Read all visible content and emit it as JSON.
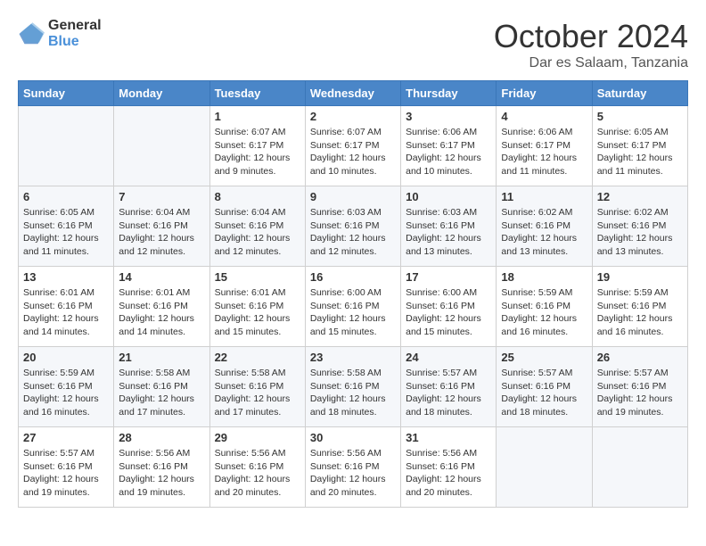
{
  "header": {
    "logo_general": "General",
    "logo_blue": "Blue",
    "month": "October 2024",
    "location": "Dar es Salaam, Tanzania"
  },
  "days_of_week": [
    "Sunday",
    "Monday",
    "Tuesday",
    "Wednesday",
    "Thursday",
    "Friday",
    "Saturday"
  ],
  "weeks": [
    [
      {
        "day": "",
        "empty": true
      },
      {
        "day": "",
        "empty": true
      },
      {
        "day": "1",
        "sunrise": "Sunrise: 6:07 AM",
        "sunset": "Sunset: 6:17 PM",
        "daylight": "Daylight: 12 hours and 9 minutes."
      },
      {
        "day": "2",
        "sunrise": "Sunrise: 6:07 AM",
        "sunset": "Sunset: 6:17 PM",
        "daylight": "Daylight: 12 hours and 10 minutes."
      },
      {
        "day": "3",
        "sunrise": "Sunrise: 6:06 AM",
        "sunset": "Sunset: 6:17 PM",
        "daylight": "Daylight: 12 hours and 10 minutes."
      },
      {
        "day": "4",
        "sunrise": "Sunrise: 6:06 AM",
        "sunset": "Sunset: 6:17 PM",
        "daylight": "Daylight: 12 hours and 11 minutes."
      },
      {
        "day": "5",
        "sunrise": "Sunrise: 6:05 AM",
        "sunset": "Sunset: 6:17 PM",
        "daylight": "Daylight: 12 hours and 11 minutes."
      }
    ],
    [
      {
        "day": "6",
        "sunrise": "Sunrise: 6:05 AM",
        "sunset": "Sunset: 6:16 PM",
        "daylight": "Daylight: 12 hours and 11 minutes."
      },
      {
        "day": "7",
        "sunrise": "Sunrise: 6:04 AM",
        "sunset": "Sunset: 6:16 PM",
        "daylight": "Daylight: 12 hours and 12 minutes."
      },
      {
        "day": "8",
        "sunrise": "Sunrise: 6:04 AM",
        "sunset": "Sunset: 6:16 PM",
        "daylight": "Daylight: 12 hours and 12 minutes."
      },
      {
        "day": "9",
        "sunrise": "Sunrise: 6:03 AM",
        "sunset": "Sunset: 6:16 PM",
        "daylight": "Daylight: 12 hours and 12 minutes."
      },
      {
        "day": "10",
        "sunrise": "Sunrise: 6:03 AM",
        "sunset": "Sunset: 6:16 PM",
        "daylight": "Daylight: 12 hours and 13 minutes."
      },
      {
        "day": "11",
        "sunrise": "Sunrise: 6:02 AM",
        "sunset": "Sunset: 6:16 PM",
        "daylight": "Daylight: 12 hours and 13 minutes."
      },
      {
        "day": "12",
        "sunrise": "Sunrise: 6:02 AM",
        "sunset": "Sunset: 6:16 PM",
        "daylight": "Daylight: 12 hours and 13 minutes."
      }
    ],
    [
      {
        "day": "13",
        "sunrise": "Sunrise: 6:01 AM",
        "sunset": "Sunset: 6:16 PM",
        "daylight": "Daylight: 12 hours and 14 minutes."
      },
      {
        "day": "14",
        "sunrise": "Sunrise: 6:01 AM",
        "sunset": "Sunset: 6:16 PM",
        "daylight": "Daylight: 12 hours and 14 minutes."
      },
      {
        "day": "15",
        "sunrise": "Sunrise: 6:01 AM",
        "sunset": "Sunset: 6:16 PM",
        "daylight": "Daylight: 12 hours and 15 minutes."
      },
      {
        "day": "16",
        "sunrise": "Sunrise: 6:00 AM",
        "sunset": "Sunset: 6:16 PM",
        "daylight": "Daylight: 12 hours and 15 minutes."
      },
      {
        "day": "17",
        "sunrise": "Sunrise: 6:00 AM",
        "sunset": "Sunset: 6:16 PM",
        "daylight": "Daylight: 12 hours and 15 minutes."
      },
      {
        "day": "18",
        "sunrise": "Sunrise: 5:59 AM",
        "sunset": "Sunset: 6:16 PM",
        "daylight": "Daylight: 12 hours and 16 minutes."
      },
      {
        "day": "19",
        "sunrise": "Sunrise: 5:59 AM",
        "sunset": "Sunset: 6:16 PM",
        "daylight": "Daylight: 12 hours and 16 minutes."
      }
    ],
    [
      {
        "day": "20",
        "sunrise": "Sunrise: 5:59 AM",
        "sunset": "Sunset: 6:16 PM",
        "daylight": "Daylight: 12 hours and 16 minutes."
      },
      {
        "day": "21",
        "sunrise": "Sunrise: 5:58 AM",
        "sunset": "Sunset: 6:16 PM",
        "daylight": "Daylight: 12 hours and 17 minutes."
      },
      {
        "day": "22",
        "sunrise": "Sunrise: 5:58 AM",
        "sunset": "Sunset: 6:16 PM",
        "daylight": "Daylight: 12 hours and 17 minutes."
      },
      {
        "day": "23",
        "sunrise": "Sunrise: 5:58 AM",
        "sunset": "Sunset: 6:16 PM",
        "daylight": "Daylight: 12 hours and 18 minutes."
      },
      {
        "day": "24",
        "sunrise": "Sunrise: 5:57 AM",
        "sunset": "Sunset: 6:16 PM",
        "daylight": "Daylight: 12 hours and 18 minutes."
      },
      {
        "day": "25",
        "sunrise": "Sunrise: 5:57 AM",
        "sunset": "Sunset: 6:16 PM",
        "daylight": "Daylight: 12 hours and 18 minutes."
      },
      {
        "day": "26",
        "sunrise": "Sunrise: 5:57 AM",
        "sunset": "Sunset: 6:16 PM",
        "daylight": "Daylight: 12 hours and 19 minutes."
      }
    ],
    [
      {
        "day": "27",
        "sunrise": "Sunrise: 5:57 AM",
        "sunset": "Sunset: 6:16 PM",
        "daylight": "Daylight: 12 hours and 19 minutes."
      },
      {
        "day": "28",
        "sunrise": "Sunrise: 5:56 AM",
        "sunset": "Sunset: 6:16 PM",
        "daylight": "Daylight: 12 hours and 19 minutes."
      },
      {
        "day": "29",
        "sunrise": "Sunrise: 5:56 AM",
        "sunset": "Sunset: 6:16 PM",
        "daylight": "Daylight: 12 hours and 20 minutes."
      },
      {
        "day": "30",
        "sunrise": "Sunrise: 5:56 AM",
        "sunset": "Sunset: 6:16 PM",
        "daylight": "Daylight: 12 hours and 20 minutes."
      },
      {
        "day": "31",
        "sunrise": "Sunrise: 5:56 AM",
        "sunset": "Sunset: 6:16 PM",
        "daylight": "Daylight: 12 hours and 20 minutes."
      },
      {
        "day": "",
        "empty": true
      },
      {
        "day": "",
        "empty": true
      }
    ]
  ]
}
